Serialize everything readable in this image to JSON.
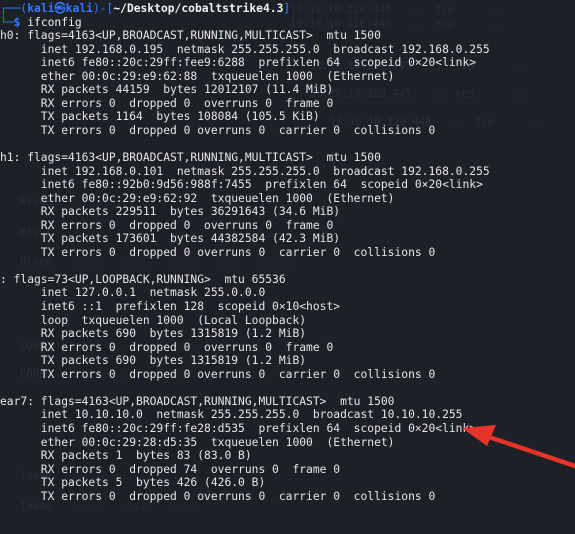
{
  "prompt": {
    "open": "┌──(",
    "user": "kali㉿kali",
    "close": ")-[",
    "path": "~/Desktop/cobaltstrike4.3",
    "end": "]",
    "dollar": "└─$",
    "command": "ifconfig"
  },
  "output_lines": [
    "h0: flags=4163<UP,BROADCAST,RUNNING,MULTICAST>  mtu 1500",
    "      inet 192.168.0.195  netmask 255.255.255.0  broadcast 192.168.0.255",
    "      inet6 fe80::20c:29ff:fee9:6288  prefixlen 64  scopeid 0×20<link>",
    "      ether 00:0c:29:e9:62:88  txqueuelen 1000  (Ethernet)",
    "      RX packets 44159  bytes 12012107 (11.4 MiB)",
    "      RX errors 0  dropped 0  overruns 0  frame 0",
    "      TX packets 1164  bytes 108084 (105.5 KiB)",
    "      TX errors 0  dropped 0 overruns 0  carrier 0  collisions 0",
    "",
    "h1: flags=4163<UP,BROADCAST,RUNNING,MULTICAST>  mtu 1500",
    "      inet 192.168.0.101  netmask 255.255.255.0  broadcast 192.168.0.255",
    "      inet6 fe80::92b0:9d56:988f:7455  prefixlen 64  scopeid 0×20<link>",
    "      ether 00:0c:29:e9:62:92  txqueuelen 1000  (Ethernet)",
    "      RX packets 229511  bytes 36291643 (34.6 MiB)",
    "      RX errors 0  dropped 0  overruns 0  frame 0",
    "      TX packets 173601  bytes 44382584 (42.3 MiB)",
    "      TX errors 0  dropped 0 overruns 0  carrier 0  collisions 0",
    "",
    ": flags=73<UP,LOOPBACK,RUNNING>  mtu 65536",
    "      inet 127.0.0.1  netmask 255.0.0.0",
    "      inet6 ::1  prefixlen 128  scopeid 0×10<host>",
    "      loop  txqueuelen 1000  (Local Loopback)",
    "      RX packets 690  bytes 1315819 (1.2 MiB)",
    "      RX errors 0  dropped 0  overruns 0  frame 0",
    "      TX packets 690  bytes 1315819 (1.2 MiB)",
    "      TX errors 0  dropped 0 overruns 0  carrier 0  collisions 0",
    "",
    "ear7: flags=4163<UP,BROADCAST,RUNNING,MULTICAST>  mtu 1500",
    "      inet 10.10.10.0  netmask 255.255.255.0  broadcast 10.10.10.255",
    "      inet6 fe80::20c:29ff:fe28:d535  prefixlen 64  scopeid 0×20<link>",
    "      ether 00:0c:29:28:d5:35  txqueuelen 1000  (Ethernet)",
    "      RX packets 1  bytes 83 (83.0 B)",
    "      RX errors 0  dropped 74  overruns 0  frame 0",
    "      TX packets 5  bytes 426 (426.0 B)",
    "      TX errors 0  dropped 0 overruns 0  carrier 0  collisions 0"
  ],
  "annotation": {
    "color": "#e8332a"
  },
  "colors": {
    "background": "#1e2027",
    "prompt_accent": "#2f7bff",
    "text": "#e6e6e6"
  }
}
